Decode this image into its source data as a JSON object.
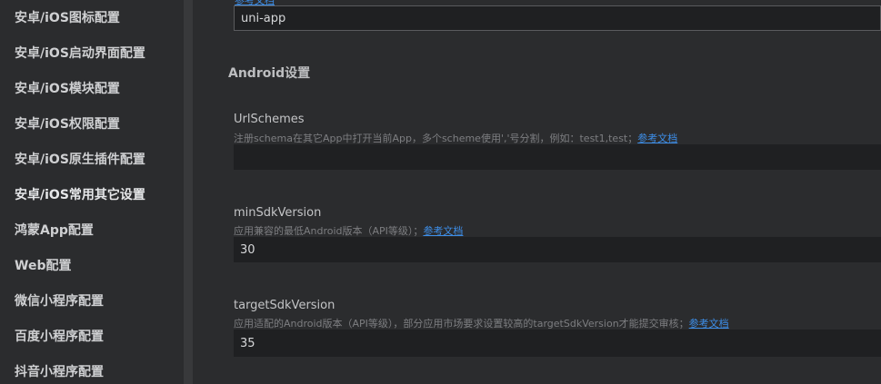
{
  "sidebar": {
    "items": [
      {
        "label": "安卓/iOS图标配置"
      },
      {
        "label": "安卓/iOS启动界面配置"
      },
      {
        "label": "安卓/iOS模块配置"
      },
      {
        "label": "安卓/iOS权限配置"
      },
      {
        "label": "安卓/iOS原生插件配置"
      },
      {
        "label": "安卓/iOS常用其它设置"
      },
      {
        "label": "鸿蒙App配置"
      },
      {
        "label": "Web配置"
      },
      {
        "label": "微信小程序配置"
      },
      {
        "label": "百度小程序配置"
      },
      {
        "label": "抖音小程序配置"
      }
    ]
  },
  "main": {
    "top_link": "参考文档",
    "top_input_value": "uni-app",
    "section_title": "Android设置",
    "fields": [
      {
        "label": "UrlSchemes",
        "description": "注册schema在其它App中打开当前App，多个scheme使用','号分割，例如：test1,test；",
        "link": "参考文档",
        "value": ""
      },
      {
        "label": "minSdkVersion",
        "description": "应用兼容的最低Android版本（API等级）；",
        "link": "参考文档",
        "value": "30"
      },
      {
        "label": "targetSdkVersion",
        "description": "应用适配的Android版本（API等级），部分应用市场要求设置较高的targetSdkVersion才能提交审核；",
        "link": "参考文档",
        "value": "35"
      }
    ]
  }
}
